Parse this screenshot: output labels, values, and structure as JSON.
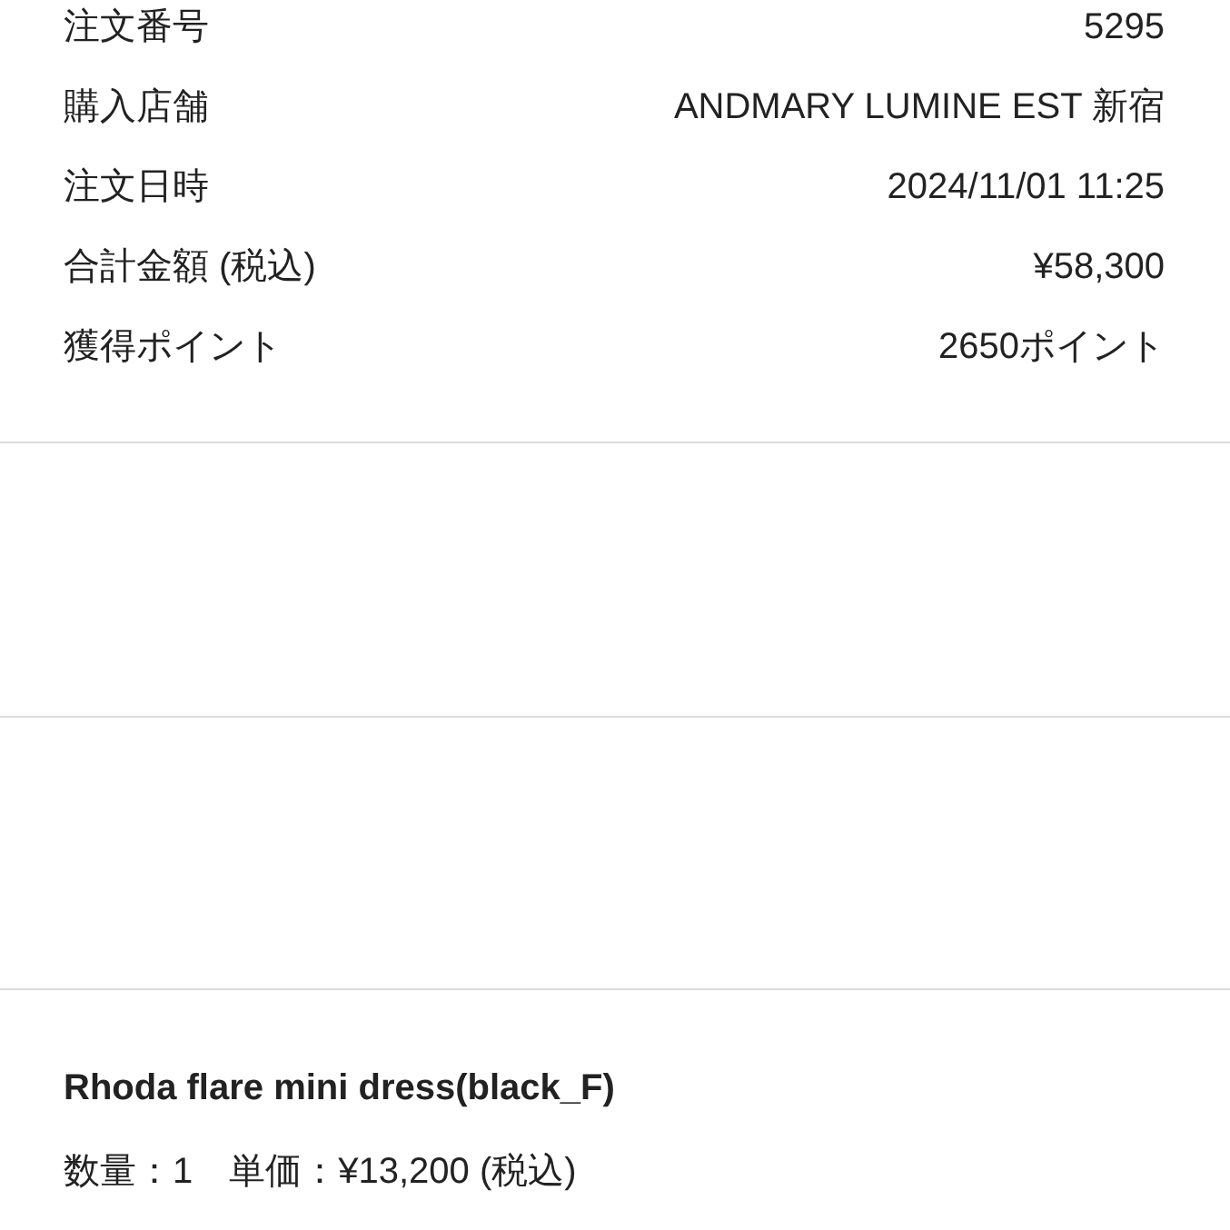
{
  "order_details": [
    {
      "label": "注文番号",
      "value": "5295"
    },
    {
      "label": "購入店舗",
      "value": "ANDMARY LUMINE EST 新宿"
    },
    {
      "label": "注文日時",
      "value": "2024/11/01 11:25"
    },
    {
      "label": "合計金額 (税込)",
      "value": "¥58,300"
    },
    {
      "label": "獲得ポイント",
      "value": "2650ポイント"
    }
  ],
  "product": {
    "name": "Rhoda flare mini dress(black_F)",
    "quantity_line": "数量：1　単価：¥13,200 (税込)"
  }
}
